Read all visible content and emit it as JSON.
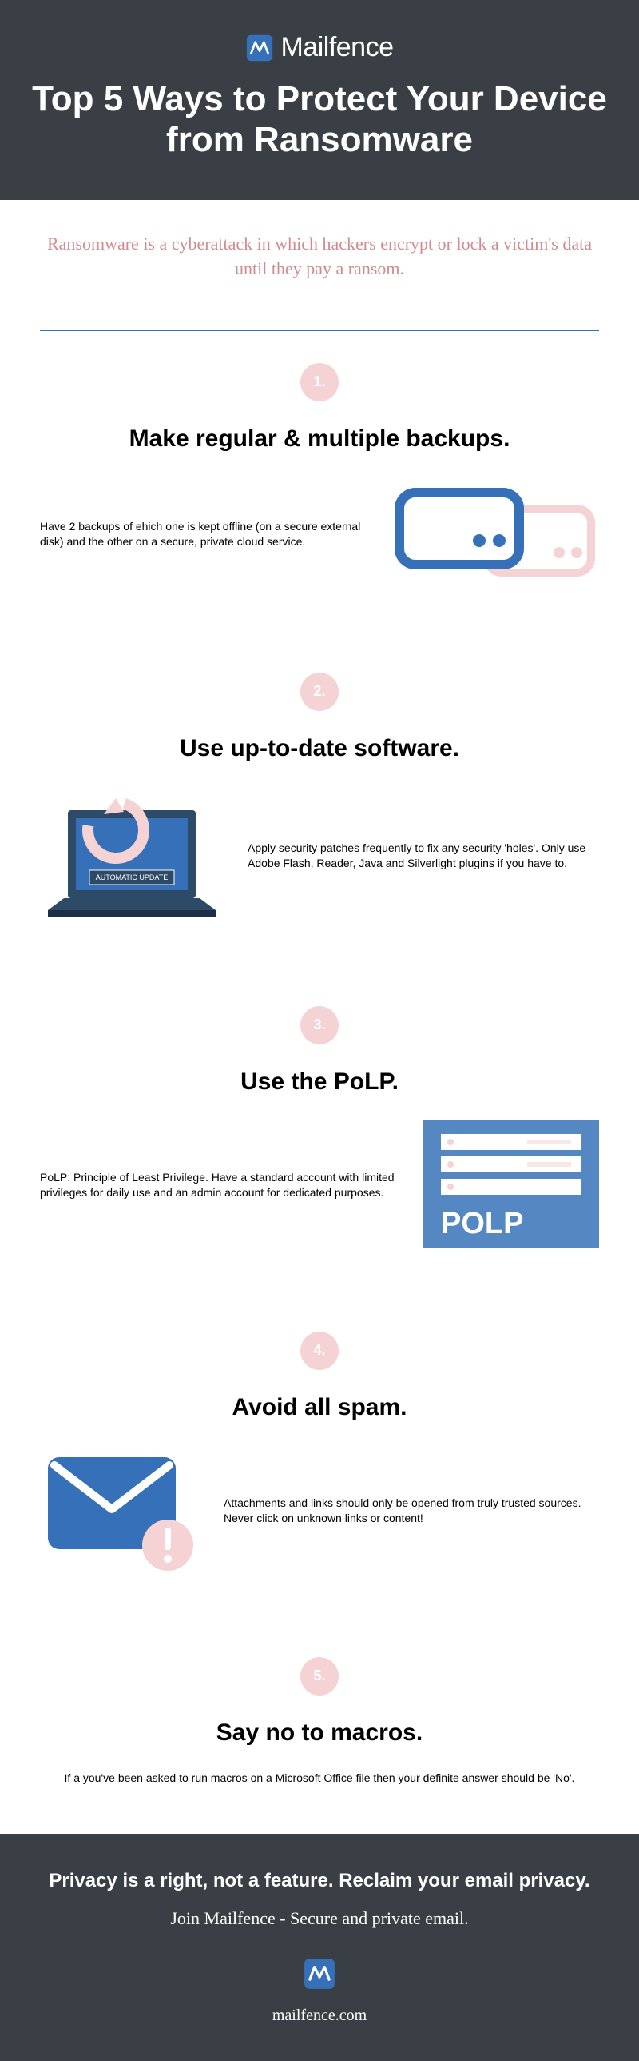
{
  "header": {
    "brand": "Mailfence",
    "title": "Top 5 Ways to Protect Your Device from Ransomware"
  },
  "intro": "Ransomware is a cyberattack in which hackers encrypt or lock a victim's data until they pay a ransom.",
  "sections": [
    {
      "num": "1.",
      "title": "Make regular & multiple backups.",
      "body": "Have 2 backups of ehich one is kept offline (on a secure external disk) and the other on a secure, private cloud service."
    },
    {
      "num": "2.",
      "title": "Use up-to-date software.",
      "body": "Apply security patches frequently to fix any security 'holes'. Only use Adobe Flash, Reader, Java and Silverlight plugins if you have to."
    },
    {
      "num": "3.",
      "title": "Use the PoLP.",
      "body": "PoLP: Principle of Least Privilege. Have a standard account with limited privileges for daily use and an admin account for dedicated purposes.",
      "badge": "POLP"
    },
    {
      "num": "4.",
      "title": "Avoid all spam.",
      "body": "Attachments and links should only be opened from truly trusted sources. Never click on unknown links or content!"
    },
    {
      "num": "5.",
      "title": "Say no to macros.",
      "body": "If a you've been asked to run macros on a Microsoft Office file then your definite answer should be 'No'."
    }
  ],
  "footer": {
    "headline": "Privacy is a right, not a feature. Reclaim your email privacy.",
    "sub": "Join Mailfence -  Secure and private email.",
    "url": "mailfence.com"
  },
  "laptop_label": "AUTOMATIC UPDATE",
  "colors": {
    "dark": "#3a3f45",
    "blue": "#3670b8",
    "pink": "#f5d2d3",
    "rose": "#d18b8f"
  }
}
